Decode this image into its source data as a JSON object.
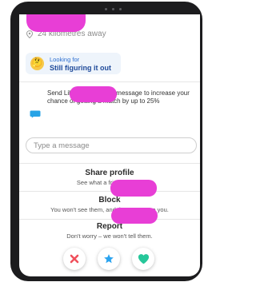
{
  "profile": {
    "distance": "24 kilometres away"
  },
  "looking_for": {
    "label": "Looking for",
    "value": "Still figuring it out"
  },
  "promo": {
    "text": "Send                         Like, and attach a message to increase your chance of getting a match by up to 25%"
  },
  "message": {
    "placeholder": "Type a message"
  },
  "actions": [
    {
      "title": "Share profile",
      "subtitle": "See what a friend thinks."
    },
    {
      "title": "Block",
      "subtitle": "You won't see them, and they won't see you."
    },
    {
      "title": "Report",
      "subtitle": "Don't worry – we won't tell them."
    }
  ],
  "icons": {
    "pin": "location-pin-icon",
    "emoji": "thinking-face-icon",
    "promo": "message-bubble-icon",
    "nope": "close-icon",
    "super_like": "star-icon",
    "like": "heart-icon"
  },
  "colors": {
    "redaction": "#e83ed6",
    "nope": "#f0505c",
    "super_like": "#2aa3ef",
    "like": "#26c79a",
    "accent_blue": "#2e6fd0"
  }
}
